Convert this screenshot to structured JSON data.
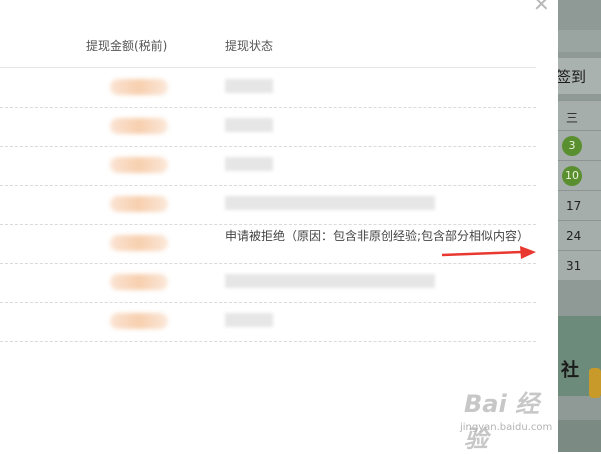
{
  "modal": {
    "columns": {
      "amount": "提现金额(税前)",
      "status": "提现状态"
    },
    "close_icon": "close-icon",
    "rows": [
      {
        "status": ""
      },
      {
        "status": ""
      },
      {
        "status": ""
      },
      {
        "status": ""
      },
      {
        "status": "申请被拒绝（原因：包含非原创经验;包含部分相似内容）"
      },
      {
        "status": ""
      },
      {
        "status": ""
      }
    ]
  },
  "background": {
    "checkin_label": "签到",
    "weekday_label": "三",
    "calendar_days": [
      "3",
      "10",
      "17",
      "24",
      "31"
    ],
    "banner_text": "社"
  },
  "watermark": {
    "logo": "Bai 经验",
    "url": "jingyan.baidu.com"
  },
  "colors": {
    "arrow": "#e8382f",
    "dot": "#5a8f2f"
  }
}
